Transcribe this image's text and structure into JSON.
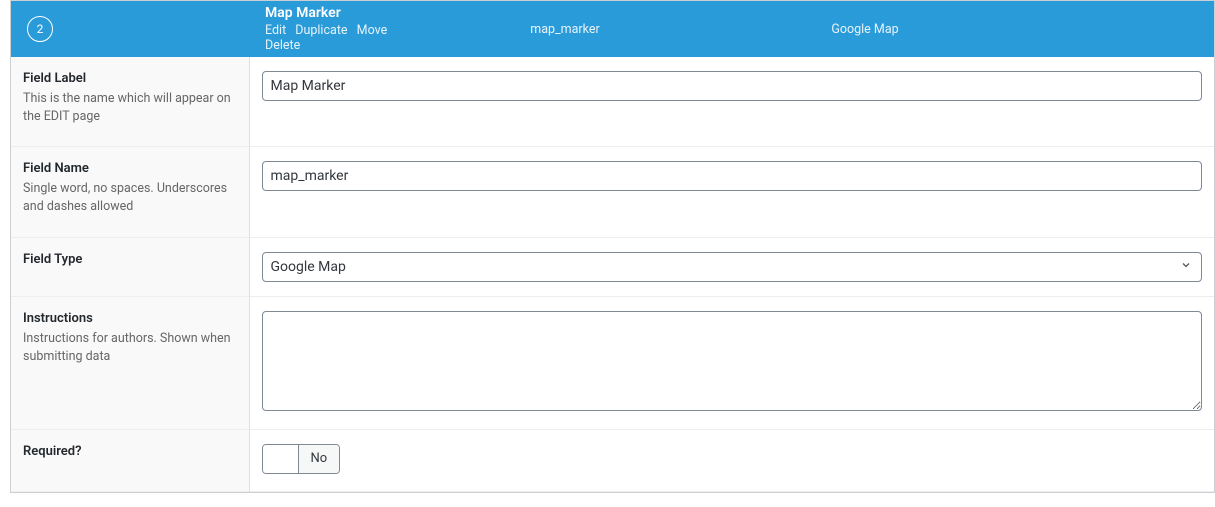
{
  "header": {
    "order": "2",
    "title": "Map Marker",
    "name": "map_marker",
    "type": "Google Map",
    "actions": {
      "edit": "Edit",
      "duplicate": "Duplicate",
      "move": "Move",
      "delete": "Delete"
    }
  },
  "rows": {
    "field_label": {
      "title": "Field Label",
      "desc": "This is the name which will appear on the EDIT page",
      "value": "Map Marker"
    },
    "field_name": {
      "title": "Field Name",
      "desc": "Single word, no spaces. Underscores and dashes allowed",
      "value": "map_marker"
    },
    "field_type": {
      "title": "Field Type",
      "value": "Google Map"
    },
    "instructions": {
      "title": "Instructions",
      "desc": "Instructions for authors. Shown when submitting data",
      "value": ""
    },
    "required": {
      "title": "Required?",
      "toggle_label": "No"
    }
  }
}
